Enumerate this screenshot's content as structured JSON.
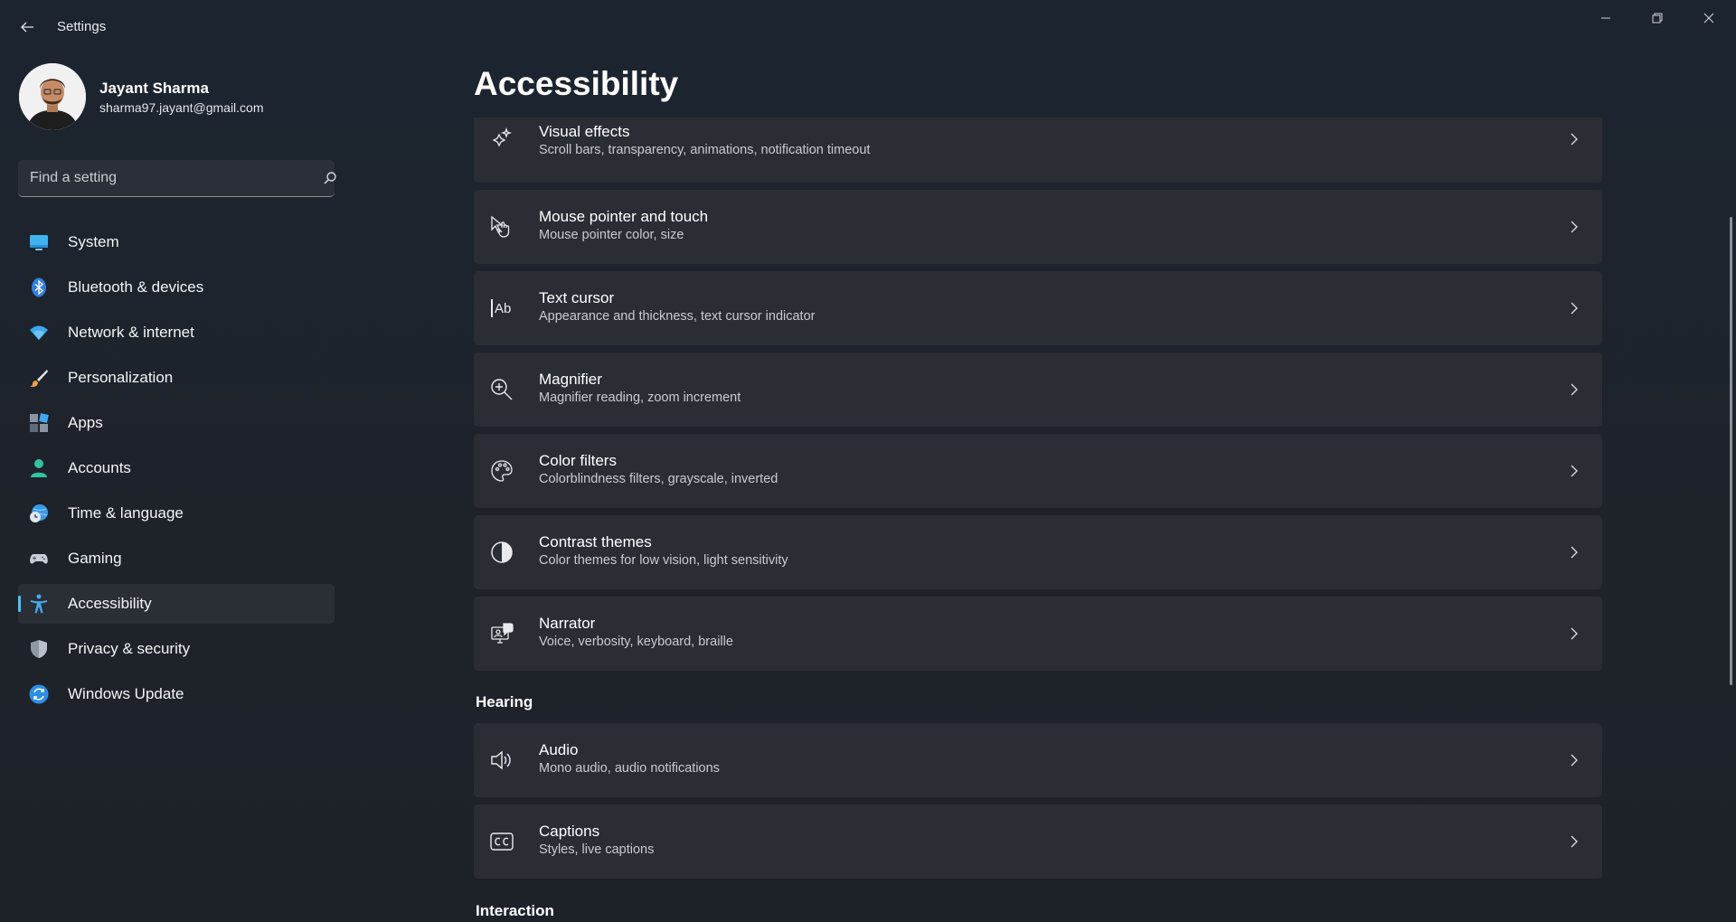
{
  "window": {
    "title": "Settings"
  },
  "profile": {
    "name": "Jayant Sharma",
    "email": "sharma97.jayant@gmail.com"
  },
  "search": {
    "placeholder": "Find a setting",
    "value": ""
  },
  "nav": {
    "items": [
      {
        "label": "System",
        "icon": "system-icon"
      },
      {
        "label": "Bluetooth & devices",
        "icon": "bluetooth-icon"
      },
      {
        "label": "Network & internet",
        "icon": "wifi-icon"
      },
      {
        "label": "Personalization",
        "icon": "brush-icon"
      },
      {
        "label": "Apps",
        "icon": "apps-icon"
      },
      {
        "label": "Accounts",
        "icon": "accounts-icon"
      },
      {
        "label": "Time & language",
        "icon": "globe-clock-icon"
      },
      {
        "label": "Gaming",
        "icon": "gamepad-icon"
      },
      {
        "label": "Accessibility",
        "icon": "accessibility-icon",
        "active": true
      },
      {
        "label": "Privacy & security",
        "icon": "shield-icon"
      },
      {
        "label": "Windows Update",
        "icon": "update-icon"
      }
    ]
  },
  "page": {
    "title": "Accessibility"
  },
  "vision": {
    "items": [
      {
        "title": "Visual effects",
        "subtitle": "Scroll bars, transparency, animations, notification timeout",
        "icon": "sparkle-icon"
      },
      {
        "title": "Mouse pointer and touch",
        "subtitle": "Mouse pointer color, size",
        "icon": "pointer-touch-icon"
      },
      {
        "title": "Text cursor",
        "subtitle": "Appearance and thickness, text cursor indicator",
        "icon": "text-cursor-icon"
      },
      {
        "title": "Magnifier",
        "subtitle": "Magnifier reading, zoom increment",
        "icon": "zoom-in-icon"
      },
      {
        "title": "Color filters",
        "subtitle": "Colorblindness filters, grayscale, inverted",
        "icon": "palette-icon"
      },
      {
        "title": "Contrast themes",
        "subtitle": "Color themes for low vision, light sensitivity",
        "icon": "contrast-icon"
      },
      {
        "title": "Narrator",
        "subtitle": "Voice, verbosity, keyboard, braille",
        "icon": "narrator-icon"
      }
    ]
  },
  "hearing": {
    "heading": "Hearing",
    "items": [
      {
        "title": "Audio",
        "subtitle": "Mono audio, audio notifications",
        "icon": "speaker-icon"
      },
      {
        "title": "Captions",
        "subtitle": "Styles, live captions",
        "icon": "captions-icon"
      }
    ]
  },
  "interaction": {
    "heading": "Interaction"
  },
  "colors": {
    "accent": "#4cc2ff",
    "card": "#2a2e34",
    "background": "#1d232b"
  }
}
